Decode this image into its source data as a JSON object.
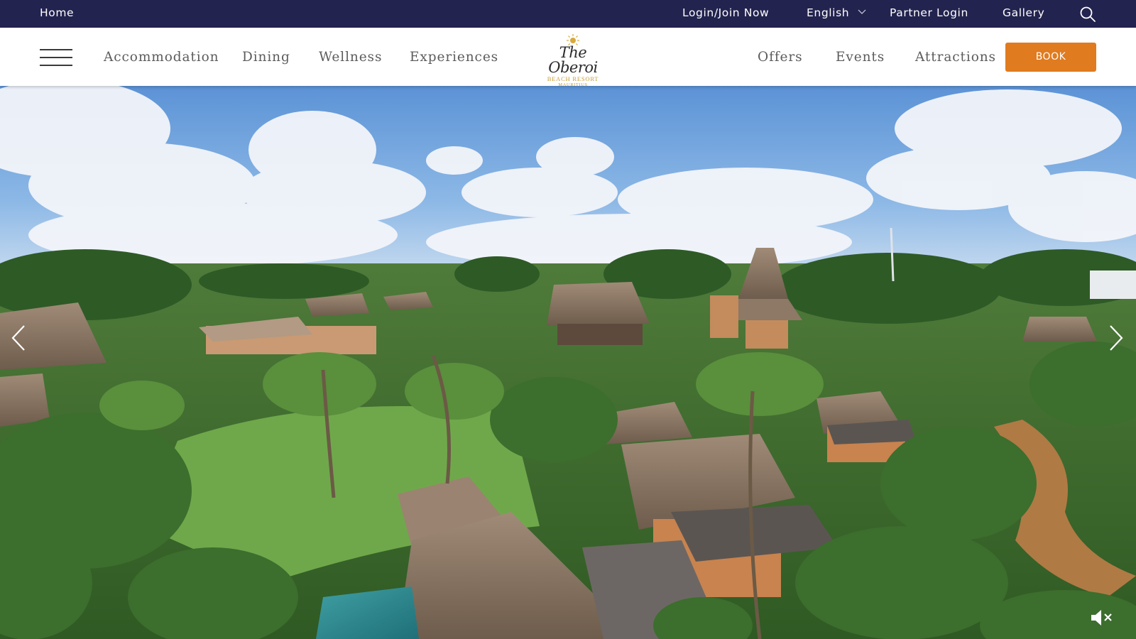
{
  "topbar": {
    "home": "Home",
    "login": "Login/Join Now",
    "language": "English",
    "partner_login": "Partner Login",
    "gallery": "Gallery",
    "background_color": "#23234f"
  },
  "nav": {
    "left_items": [
      {
        "label": "Accommodation"
      },
      {
        "label": "Dining"
      },
      {
        "label": "Wellness"
      },
      {
        "label": "Experiences"
      }
    ],
    "right_items": [
      {
        "label": "Offers"
      },
      {
        "label": "Events"
      },
      {
        "label": "Attractions"
      }
    ],
    "book_label": "BOOK",
    "book_color": "#e07b1f"
  },
  "logo": {
    "name": "The Oberoi",
    "line1": "BEACH RESORT",
    "line2": "MAURITIUS"
  },
  "hero": {
    "icons": [
      "chevron-left-icon",
      "chevron-right-icon",
      "mute-icon",
      "search-icon",
      "hamburger-menu-icon"
    ]
  }
}
